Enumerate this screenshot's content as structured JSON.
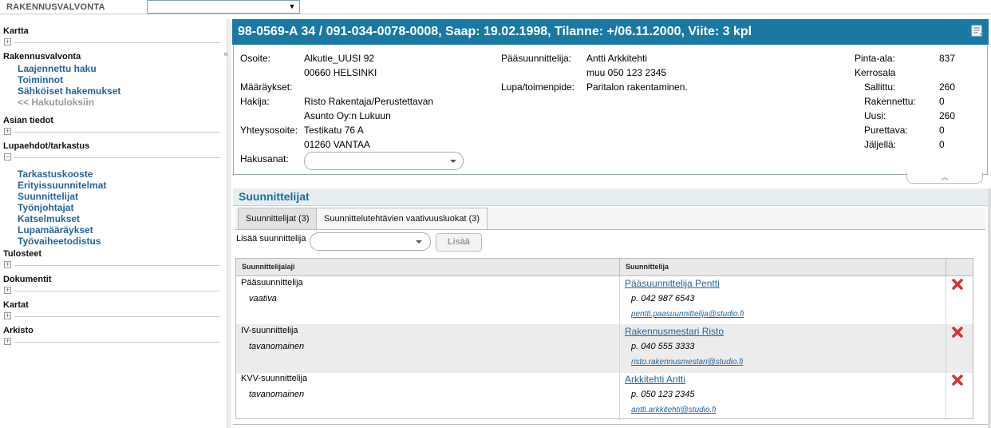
{
  "app": {
    "title": "RAKENNUSVALVONTA",
    "select_value": ""
  },
  "sidebar": {
    "sections": [
      {
        "title": "Kartta",
        "toggle": "+",
        "links": []
      },
      {
        "title": "Rakennusvalvonta",
        "toggle": "",
        "links": [
          "Laajennettu haku",
          "Toiminnot",
          "Sähköiset hakemukset",
          "<< Hakutuloksiin"
        ]
      },
      {
        "title": "Asian tiedot",
        "toggle": "+",
        "links": []
      },
      {
        "title": "Lupaehdot/tarkastus",
        "toggle": "−",
        "links": [
          "Tarkastuskooste",
          "Erityissuunnitelmat",
          "Suunnittelijat",
          "Työnjohtajat",
          "Katselmukset",
          "Lupamääräykset",
          "Työvaiheetodistus"
        ]
      },
      {
        "title": "Tulosteet",
        "toggle": "+",
        "links": []
      },
      {
        "title": "Dokumentit",
        "toggle": "+",
        "links": []
      },
      {
        "title": "Kartat",
        "toggle": "+",
        "links": []
      },
      {
        "title": "Arkisto",
        "toggle": "+",
        "links": []
      }
    ],
    "collapse_glyph": "«"
  },
  "header": {
    "title": "98-0569-A 34 / 091-034-0078-0008, Saap: 19.02.1998, Tilanne: +/06.11.2000, Viite: 3 kpl"
  },
  "info": {
    "osoite_label": "Osoite:",
    "osoite_1": "Alkutie_UUSI 92",
    "osoite_2": "00660 HELSINKI",
    "maaraykset_label": "Määräykset:",
    "hakija_label": "Hakija:",
    "hakija_1": "Risto Rakentaja/Perustettavan",
    "hakija_2": "Asunto Oy:n Lukuun",
    "yhteys_label": "Yhteysosoite:",
    "yhteys_1": "Testikatu 76 A",
    "yhteys_2": "01260 VANTAA",
    "hakusanat_label": "Hakusanat:",
    "paasuunnittelija_label": "Pääsuunnittelija:",
    "paasuunnittelija_1": "Antti Arkkitehti",
    "paasuunnittelija_2": "muu 050 123 2345",
    "lupa_label": "Lupa/toimenpide:",
    "lupa_value": "Paritalon rakentaminen.",
    "pinta_label": "Pinta-ala:",
    "pinta_value": "837",
    "kerrosala_label": "Kerrosala",
    "sallittu_label": "Sallittu:",
    "sallittu_value": "260",
    "rakennettu_label": "Rakennettu:",
    "rakennettu_value": "0",
    "uusi_label": "Uusi:",
    "uusi_value": "260",
    "purettava_label": "Purettava:",
    "purettava_value": "0",
    "jaljella_label": "Jäljellä:",
    "jaljella_value": "0",
    "collapse_glyph": "︽"
  },
  "section": {
    "title": "Suunnittelijat"
  },
  "tabs": [
    {
      "label": "Suunnittelijat (3)",
      "active": true
    },
    {
      "label": "Suunnittelutehtävien vaativuusluokat (3)",
      "active": false
    }
  ],
  "add": {
    "label": "Lisää suunnittelija",
    "button": "Lisää"
  },
  "table": {
    "headers": [
      "Suunnittelijalaji",
      "Suunnittelija"
    ],
    "rows": [
      {
        "type": "Pääsuunnittelija",
        "level": "vaativa",
        "name": "Pääsuunnittelija Pentti",
        "phone": "p. 042 987 6543",
        "email": "pentti.paasuunnittelija@studio.fi"
      },
      {
        "type": "IV-suunnittelija",
        "level": "tavanomainen",
        "name": "Rakennusmestari Risto",
        "phone": "p. 040 555 3333",
        "email": "risto.rakennusmestari@studio.fi"
      },
      {
        "type": "KVV-suunnittelija",
        "level": "tavanomainen",
        "name": "Arkkitehti Antti",
        "phone": "p. 050 123 2345",
        "email": "antti.arkkitehti@studio.fi"
      }
    ]
  },
  "colors": {
    "header_bg": "#1a79a3",
    "link": "#23649b",
    "delete": "#d9302c"
  }
}
